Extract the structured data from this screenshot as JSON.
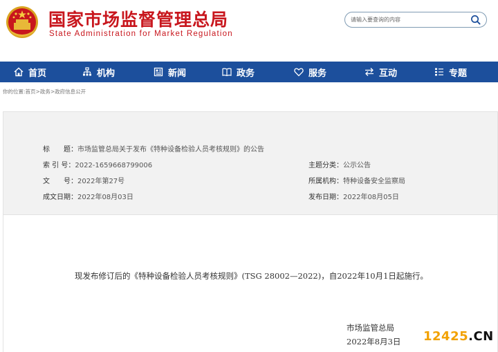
{
  "header": {
    "title_cn": "国家市场监督管理总局",
    "title_en": "State Administration for Market Regulation",
    "search_placeholder": "请输入要查询的内容"
  },
  "nav": {
    "items": [
      {
        "label": "首页",
        "icon": "home-icon"
      },
      {
        "label": "机构",
        "icon": "org-icon"
      },
      {
        "label": "新闻",
        "icon": "news-icon"
      },
      {
        "label": "政务",
        "icon": "book-icon"
      },
      {
        "label": "服务",
        "icon": "heart-icon"
      },
      {
        "label": "互动",
        "icon": "exchange-icon"
      },
      {
        "label": "专题",
        "icon": "list-icon"
      }
    ]
  },
  "breadcrumb": {
    "prefix": "你的位置:",
    "items": [
      "首页",
      "政务",
      "政府信息公开"
    ],
    "separator": ">"
  },
  "info": {
    "title_label": "标　　题：",
    "title_value": "市场监管总局关于发布《特种设备检验人员考核规则》的公告",
    "index_label": "索 引 号：",
    "index_value": "2022-1659668799006",
    "topic_label": "主题分类：",
    "topic_value": "公示公告",
    "doc_label": "文　　号：",
    "doc_value": "2022年第27号",
    "org_label": "所属机构：",
    "org_value": "特种设备安全监察局",
    "created_label": "成文日期：",
    "created_value": "2022年08月03日",
    "published_label": "发布日期：",
    "published_value": "2022年08月05日"
  },
  "body": {
    "paragraph": "现发布修订后的《特种设备检验人员考核规则》(TSG 28002—2022)，自2022年10月1日起施行。",
    "signature_org": "市场监管总局",
    "signature_date": "2022年8月3日"
  },
  "watermark": {
    "number": "12425",
    "suffix": ".CN"
  },
  "colors": {
    "brand_red": "#c8161d",
    "nav_blue": "#1c4f9c",
    "watermark_orange": "#f2a100"
  }
}
